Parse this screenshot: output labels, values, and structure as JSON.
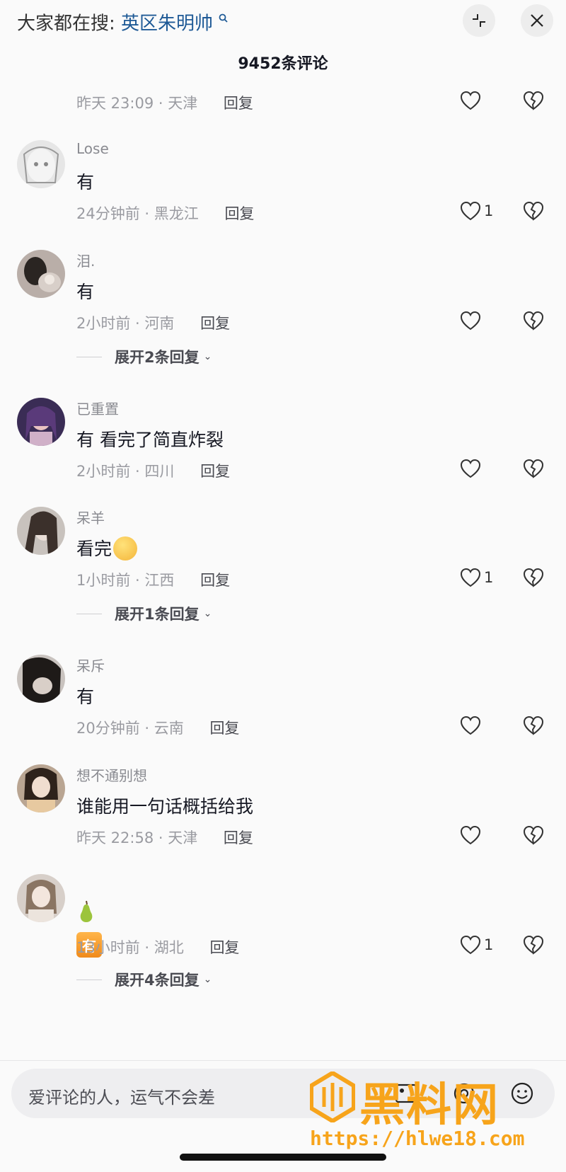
{
  "header": {
    "search_prefix": "大家都在搜:",
    "search_keyword": "英区朱明帅",
    "comment_count_title": "9452条评论"
  },
  "comments": [
    {
      "username": "",
      "content": "",
      "time_location": "昨天 23:09 · 天津",
      "reply_label": "回复",
      "likes": ""
    },
    {
      "username": "Lose",
      "content": "有",
      "time_location": "24分钟前 · 黑龙江",
      "reply_label": "回复",
      "likes": "1"
    },
    {
      "username": "泪.",
      "content": "有",
      "time_location": "2小时前 · 河南",
      "reply_label": "回复",
      "likes": "",
      "expand_label": "展开2条回复"
    },
    {
      "username": "已重置",
      "content": "有 看完了简直炸裂",
      "time_location": "2小时前 · 四川",
      "reply_label": "回复",
      "likes": ""
    },
    {
      "username": "呆羊",
      "content": "看完",
      "time_location": "1小时前 · 江西",
      "reply_label": "回复",
      "likes": "1",
      "expand_label": "展开1条回复"
    },
    {
      "username": "呆斥",
      "content": "有",
      "time_location": "20分钟前 · 云南",
      "reply_label": "回复",
      "likes": ""
    },
    {
      "username": "想不通别想",
      "content": "谁能用一句话概括给我",
      "time_location": "昨天 22:58 · 天津",
      "reply_label": "回复",
      "likes": ""
    },
    {
      "username": "",
      "content": "",
      "badge_text": "有",
      "time_location": "13小时前 · 湖北",
      "reply_label": "回复",
      "likes": "1",
      "expand_label": "展开4条回复"
    }
  ],
  "input": {
    "placeholder": "爱评论的人，运气不会差"
  },
  "watermark": {
    "text": "黑料网",
    "url": "https://hlwe18.com"
  },
  "icons": {
    "collapse": "collapse-icon",
    "close": "close-icon",
    "like": "heart-icon",
    "dislike": "broken-heart-icon"
  },
  "colors": {
    "background": "#fafafa",
    "keyword": "#1f5a96",
    "meta": "#9a9ba1",
    "watermark": "#f7a41b"
  }
}
